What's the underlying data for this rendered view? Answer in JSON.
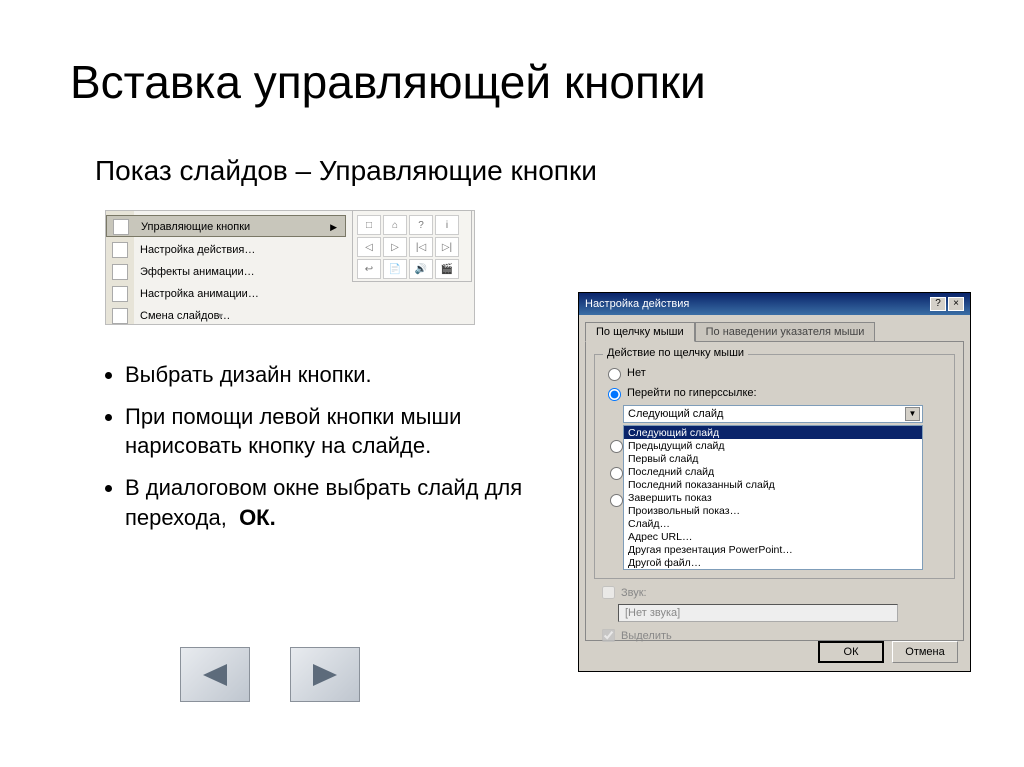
{
  "title": "Вставка управляющей кнопки",
  "subtitle": "Показ слайдов – Управляющие кнопки",
  "menu": {
    "items": [
      "Управляющие кнопки",
      "Настройка действия…",
      "Эффекты анимации…",
      "Настройка анимации…",
      "Смена слайдов…"
    ]
  },
  "bullets": [
    "Выбрать дизайн кнопки.",
    "При помощи левой кнопки мыши нарисовать кнопку на слайде.",
    "В диалоговом окне выбрать слайд для перехода,  ОК."
  ],
  "dialog": {
    "title": "Настройка действия",
    "tabs": {
      "active": "По щелчку мыши",
      "inactive": "По наведении указателя мыши"
    },
    "group": "Действие по щелчку мыши",
    "radio_none": "Нет",
    "radio_link": "Перейти по гиперссылке:",
    "combo_value": "Следующий слайд",
    "options": [
      "Следующий слайд",
      "Предыдущий слайд",
      "Первый слайд",
      "Последний слайд",
      "Последний показанный слайд",
      "Завершить показ",
      "Произвольный показ…",
      "Слайд…",
      "Адрес URL…",
      "Другая презентация PowerPoint…",
      "Другой файл…"
    ],
    "sound_label": "Звук:",
    "sound_value": "[Нет звука]",
    "highlight_label": "Выделить",
    "ok": "ОК",
    "cancel": "Отмена"
  }
}
